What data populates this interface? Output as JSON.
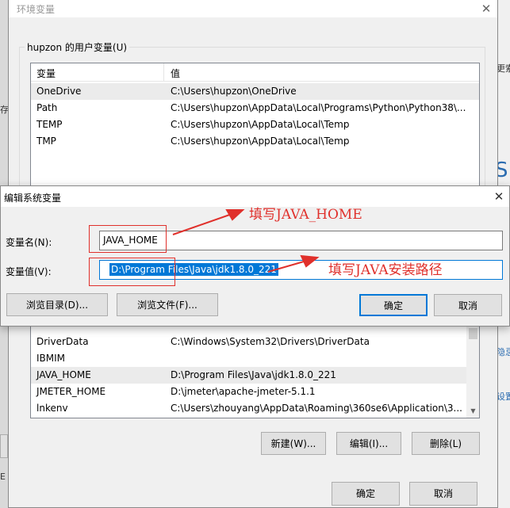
{
  "background": {
    "right_fragments": [
      "更索",
      "S",
      "隐忌",
      "设置"
    ],
    "left_fragments": [
      "存",
      "E"
    ]
  },
  "env_dialog": {
    "title": "环境变量",
    "close": "✕",
    "user_group": {
      "caption": "hupzon 的用户变量(U)",
      "columns": [
        "变量",
        "值"
      ],
      "rows": [
        {
          "name": "OneDrive",
          "value": "C:\\Users\\hupzon\\OneDrive"
        },
        {
          "name": "Path",
          "value": "C:\\Users\\hupzon\\AppData\\Local\\Programs\\Python\\Python38\\..."
        },
        {
          "name": "TEMP",
          "value": "C:\\Users\\hupzon\\AppData\\Local\\Temp"
        },
        {
          "name": "TMP",
          "value": "C:\\Users\\hupzon\\AppData\\Local\\Temp"
        }
      ]
    },
    "system_group": {
      "rows": [
        {
          "name": "DriverData",
          "value": "C:\\Windows\\System32\\Drivers\\DriverData"
        },
        {
          "name": "IBMIM",
          "value": ""
        },
        {
          "name": "JAVA_HOME",
          "value": "D:\\Program Files\\Java\\jdk1.8.0_221"
        },
        {
          "name": "JMETER_HOME",
          "value": "D:\\jmeter\\apache-jmeter-5.1.1"
        },
        {
          "name": "lnkenv",
          "value": "C:\\Users\\zhouyang\\AppData\\Roaming\\360se6\\Application\\3..."
        }
      ],
      "buttons": {
        "new": "新建(W)...",
        "edit": "编辑(I)...",
        "delete": "删除(L)"
      }
    },
    "ok": "确定",
    "cancel": "取消"
  },
  "edit_dialog": {
    "title": "编辑系统变量",
    "close": "✕",
    "name_label": "变量名(N):",
    "name_value": "JAVA_HOME",
    "value_label": "变量值(V):",
    "value_value": "D:\\Program Files\\Java\\jdk1.8.0_221",
    "browse_dir": "浏览目录(D)...",
    "browse_file": "浏览文件(F)...",
    "ok": "确定",
    "cancel": "取消"
  },
  "annotations": {
    "name_hint": "填写JAVA_HOME",
    "value_hint": "填写JAVA安装路径",
    "color": "#e0302b"
  }
}
